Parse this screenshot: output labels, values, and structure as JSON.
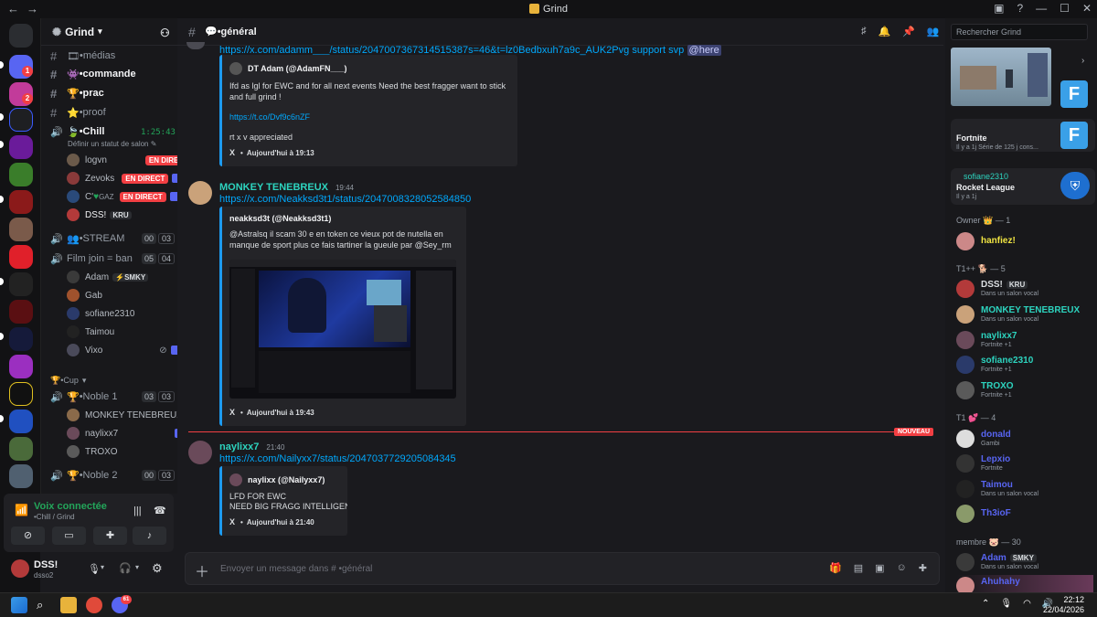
{
  "window": {
    "title": "Grind"
  },
  "server": {
    "name": "Grind"
  },
  "channels": [
    {
      "label": "•médias"
    },
    {
      "label": "•commande"
    },
    {
      "label": "•prac"
    },
    {
      "label": "•proof"
    },
    {
      "label": "•Chill",
      "timer": "1:25:43",
      "status_hint": "Définir un statut de salon"
    },
    {
      "label": "•STREAM",
      "count_a": "00",
      "count_b": "03"
    },
    {
      "label": "Film join = ban",
      "count_a": "05",
      "count_b": "04"
    },
    {
      "label": "•Cup"
    },
    {
      "label": "•Noble 1",
      "count_a": "03",
      "count_b": "03"
    },
    {
      "label": "•Noble 2",
      "count_a": "00",
      "count_b": "03"
    }
  ],
  "chill_members": [
    {
      "name": "logvn",
      "live": "EN DIRECT"
    },
    {
      "name": "Zevoks",
      "live": "EN DIRECT"
    },
    {
      "name": "C' ",
      "extra": "GAZ",
      "live": "EN DIRECT"
    },
    {
      "name": "DSS!",
      "tag": "KRU"
    }
  ],
  "film_members": [
    {
      "name": "Adam",
      "tag": "SMKY"
    },
    {
      "name": "Gab"
    },
    {
      "name": "sofiane2310"
    },
    {
      "name": "Taimou"
    },
    {
      "name": "Vixo"
    }
  ],
  "noble1_members": [
    {
      "name": "MONKEY TENEBREUX"
    },
    {
      "name": "naylixx7"
    },
    {
      "name": "TROXO"
    }
  ],
  "voice": {
    "title": "Voix connectée",
    "sub": "•Chill / Grind"
  },
  "user": {
    "name": "DSS!",
    "sub": "dsso2"
  },
  "channel_header": {
    "name": "•général"
  },
  "messages": [
    {
      "link": "https://x.com/adamm___/status/2047007367314515387s=46&t=lz0Bedbxuh7a9c_AUK2Pvg support svp",
      "mention": "@here",
      "embed": {
        "author": "DT Adam (@AdamFN___)",
        "desc": "Ifd as lgl for EWC and for all next events Need the best fragger want to stick and full grind !",
        "link": "https://t.co/Dvf9c6nZF",
        "desc2": "rt x v appreciated",
        "footer_x": "X",
        "footer": "Aujourd'hui à 19:13"
      }
    },
    {
      "author": "MONKEY TENEBREUX",
      "time": "19:44",
      "link": "https://x.com/Neakksd3t1/status/2047008328052584850",
      "embed": {
        "author": "neakksd3t (@Neakksd3t1)",
        "desc": "@Astralsq il scam 30 e en token ce vieux pot de nutella en manque de sport plus ce fais tartiner la gueule par @Sey_rm",
        "footer_x": "X",
        "footer": "Aujourd'hui à 19:43"
      }
    },
    {
      "author": "naylixx7",
      "time": "21:40",
      "link": "https://x.com/Nailyxx7/status/2047037729205084345",
      "embed": {
        "author": "naylixx (@Nailyxx7)",
        "desc": "LFD FOR EWC",
        "desc2": "NEED BIG FRAGG INTELLIGENT",
        "footer_x": "X",
        "footer": "Aujourd'hui à 21:40"
      }
    }
  ],
  "new_label": "NOUVEAU",
  "composer": {
    "placeholder": "Envoyer un message dans # •général"
  },
  "search": {
    "placeholder": "Rechercher Grind"
  },
  "activities": [
    {
      "user": "",
      "game": "Fortnite",
      "sub": "Il y a 1j  Série de 125 j cons..."
    },
    {
      "user": "sofiane2310",
      "game": "Rocket League",
      "sub": "Il y a 1j"
    }
  ],
  "member_groups": [
    {
      "label": "Owner 👑 — 1",
      "members": [
        {
          "name": "hanfiez!",
          "status": "",
          "color": "#f0e442"
        }
      ]
    },
    {
      "label": "T1++ 🐕 — 5",
      "members": [
        {
          "name": "DSS!",
          "tag": "KRU",
          "status": "Dans un salon vocal",
          "color": "#dbdee1"
        },
        {
          "name": "MONKEY TENEBREUX",
          "status": "Dans un salon vocal",
          "color": "#2dd4bf"
        },
        {
          "name": "naylixx7",
          "status": "Fortnite +1",
          "color": "#2dd4bf"
        },
        {
          "name": "sofiane2310",
          "status": "Fortnite +1",
          "color": "#2dd4bf"
        },
        {
          "name": "TROXO",
          "status": "Fortnite +1",
          "color": "#2dd4bf"
        }
      ]
    },
    {
      "label": "T1 💕 — 4",
      "members": [
        {
          "name": "donald",
          "status": "Gambi",
          "color": "#5865f2"
        },
        {
          "name": "Lepxio",
          "status": "Fortnite",
          "color": "#5865f2"
        },
        {
          "name": "Taimou",
          "status": "Dans un salon vocal",
          "color": "#5865f2"
        },
        {
          "name": "Th3ioF",
          "status": "",
          "color": "#5865f2"
        }
      ]
    },
    {
      "label": "membre 🐷 — 30",
      "members": [
        {
          "name": "Adam",
          "tag": "SMKY",
          "status": "Dans un salon vocal",
          "color": "#5865f2"
        },
        {
          "name": "Ahuhahy",
          "status": "",
          "color": "#5865f2"
        }
      ]
    }
  ],
  "taskbar": {
    "time": "22:12",
    "date": "22/04/2026",
    "discord_badge": "61"
  },
  "colors": {
    "accent": "#5865f2",
    "online": "#23a55a",
    "danger": "#f23f43",
    "link": "#00a8fc"
  }
}
